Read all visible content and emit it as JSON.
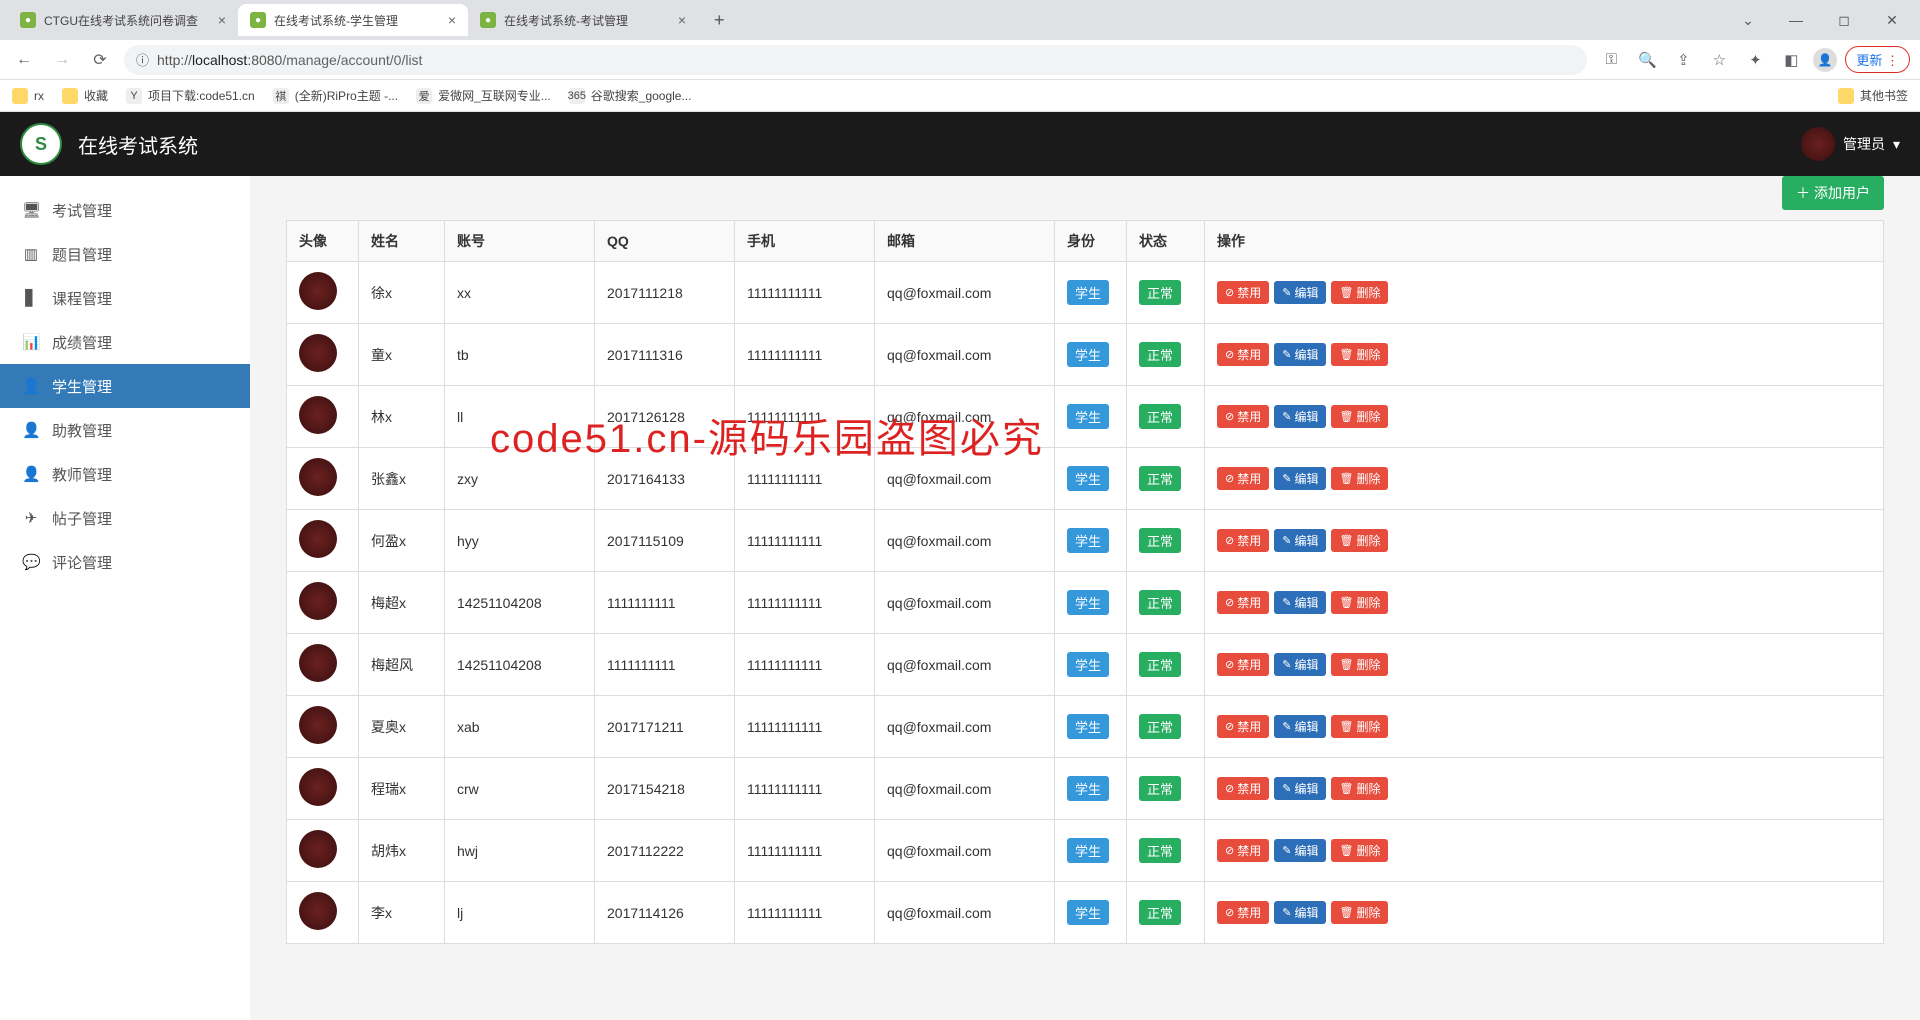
{
  "browser": {
    "tabs": [
      {
        "title": "CTGU在线考试系统问卷调查",
        "active": false
      },
      {
        "title": "在线考试系统-学生管理",
        "active": true
      },
      {
        "title": "在线考试系统-考试管理",
        "active": false
      }
    ],
    "url_host": "localhost",
    "url_port": ":8080",
    "url_path": "/manage/account/0/list",
    "url_prefix": "http://",
    "update_label": "更新",
    "bookmarks": [
      {
        "label": "rx",
        "icon": "folder"
      },
      {
        "label": "收藏",
        "icon": "folder"
      },
      {
        "label": "项目下载:code51.cn",
        "icon": "Y"
      },
      {
        "label": "(全新)RiPro主题 -...",
        "icon": "祺"
      },
      {
        "label": "爱微网_互联网专业...",
        "icon": "爱"
      },
      {
        "label": "谷歌搜索_google...",
        "icon": "365"
      }
    ],
    "other_bookmarks": "其他书签"
  },
  "app": {
    "title": "在线考试系统",
    "user_label": "管理员"
  },
  "sidebar": {
    "items": [
      {
        "label": "考试管理",
        "icon": "🖥"
      },
      {
        "label": "题目管理",
        "icon": "▥"
      },
      {
        "label": "课程管理",
        "icon": "▋"
      },
      {
        "label": "成绩管理",
        "icon": "📊"
      },
      {
        "label": "学生管理",
        "icon": "👤",
        "active": true
      },
      {
        "label": "助教管理",
        "icon": "👤"
      },
      {
        "label": "教师管理",
        "icon": "👤"
      },
      {
        "label": "帖子管理",
        "icon": "✈"
      },
      {
        "label": "评论管理",
        "icon": "💬"
      }
    ]
  },
  "toolbar": {
    "add_label": "添加用户"
  },
  "table": {
    "headers": {
      "avatar": "头像",
      "name": "姓名",
      "account": "账号",
      "qq": "QQ",
      "phone": "手机",
      "email": "邮箱",
      "role": "身份",
      "status": "状态",
      "ops": "操作"
    },
    "role_label": "学生",
    "status_label": "正常",
    "op_disable": "禁用",
    "op_edit": "编辑",
    "op_delete": "删除",
    "rows": [
      {
        "name": "徐x",
        "account": "xx",
        "qq": "2017111218",
        "phone": "11111111111",
        "email": "qq@foxmail.com"
      },
      {
        "name": "童x",
        "account": "tb",
        "qq": "2017111316",
        "phone": "11111111111",
        "email": "qq@foxmail.com"
      },
      {
        "name": "林x",
        "account": "ll",
        "qq": "2017126128",
        "phone": "11111111111",
        "email": "qq@foxmail.com"
      },
      {
        "name": "张鑫x",
        "account": "zxy",
        "qq": "2017164133",
        "phone": "11111111111",
        "email": "qq@foxmail.com"
      },
      {
        "name": "何盈x",
        "account": "hyy",
        "qq": "2017115109",
        "phone": "11111111111",
        "email": "qq@foxmail.com"
      },
      {
        "name": "梅超x",
        "account": "14251104208",
        "qq": "1111111111",
        "phone": "11111111111",
        "email": "qq@foxmail.com"
      },
      {
        "name": "梅超风",
        "account": "14251104208",
        "qq": "1111111111",
        "phone": "11111111111",
        "email": "qq@foxmail.com"
      },
      {
        "name": "夏奥x",
        "account": "xab",
        "qq": "2017171211",
        "phone": "11111111111",
        "email": "qq@foxmail.com"
      },
      {
        "name": "程瑞x",
        "account": "crw",
        "qq": "2017154218",
        "phone": "11111111111",
        "email": "qq@foxmail.com"
      },
      {
        "name": "胡炜x",
        "account": "hwj",
        "qq": "2017112222",
        "phone": "11111111111",
        "email": "qq@foxmail.com"
      },
      {
        "name": "李x",
        "account": "lj",
        "qq": "2017114126",
        "phone": "11111111111",
        "email": "qq@foxmail.com"
      }
    ]
  },
  "watermark": "code51.cn-源码乐园盗图必究"
}
